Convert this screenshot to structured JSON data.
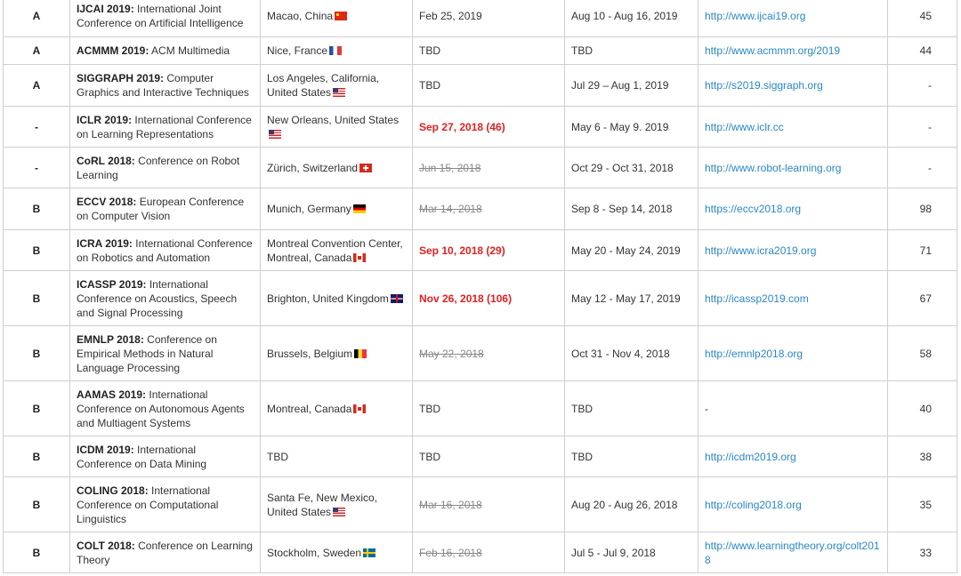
{
  "rows": [
    {
      "rank": "A",
      "abbr": "IJCAI 2019:",
      "full": " International Joint Conference on Artificial Intelligence",
      "location": "Macao, China",
      "flag": "china-flag-icon",
      "deadline": "Feb 25, 2019",
      "deadline_style": "normal",
      "dates": "Aug 10 - Aug 16, 2019",
      "url": "http://www.ijcai19.org",
      "h5": "45"
    },
    {
      "rank": "A",
      "abbr": "ACMMM 2019:",
      "full": " ACM Multimedia",
      "location": "Nice, France",
      "flag": "france-flag-icon",
      "deadline": "TBD",
      "deadline_style": "normal",
      "dates": "TBD",
      "url": "http://www.acmmm.org/2019",
      "h5": "44"
    },
    {
      "rank": "A",
      "abbr": "SIGGRAPH 2019:",
      "full": " Computer Graphics and Interactive Techniques",
      "location": "Los Angeles, California, United States",
      "flag": "usa-flag-icon",
      "deadline": "TBD",
      "deadline_style": "normal",
      "dates": "Jul 29 – Aug 1, 2019",
      "url": "http://s2019.siggraph.org",
      "h5": "-"
    },
    {
      "rank": "-",
      "abbr": "ICLR 2019:",
      "full": " International Conference on Learning Representations",
      "location": "New Orleans, United States",
      "flag": "usa-flag-icon",
      "deadline": "Sep 27, 2018 (46)",
      "deadline_style": "urgent",
      "dates": "May 6 - May 9. 2019",
      "url": "http://www.iclr.cc",
      "h5": "-"
    },
    {
      "rank": "-",
      "abbr": "CoRL 2018:",
      "full": " Conference on Robot Learning",
      "location": "Zürich, Switzerland",
      "flag": "switzerland-flag-icon",
      "deadline": "Jun 15, 2018",
      "deadline_style": "past",
      "dates": "Oct 29 - Oct 31, 2018",
      "url": "http://www.robot-learning.org",
      "h5": "-"
    },
    {
      "rank": "B",
      "abbr": "ECCV 2018:",
      "full": " European Conference on Computer Vision",
      "location": "Munich, Germany",
      "flag": "germany-flag-icon",
      "deadline": "Mar 14, 2018",
      "deadline_style": "past",
      "dates": "Sep 8 - Sep 14, 2018",
      "url": "https://eccv2018.org",
      "h5": "98"
    },
    {
      "rank": "B",
      "abbr": "ICRA 2019:",
      "full": " International Conference on Robotics and Automation",
      "location": "Montreal Convention Center, Montreal, Canada",
      "flag": "canada-flag-icon",
      "deadline": "Sep 10, 2018 (29)",
      "deadline_style": "urgent",
      "dates": "May 20 - May 24, 2019",
      "url": "http://www.icra2019.org",
      "h5": "71"
    },
    {
      "rank": "B",
      "abbr": "ICASSP 2019:",
      "full": " International Conference on Acoustics, Speech and Signal Processing",
      "location": "Brighton, United Kingdom",
      "flag": "uk-flag-icon",
      "deadline": "Nov 26, 2018 (106)",
      "deadline_style": "urgent",
      "dates": "May 12 - May 17, 2019",
      "url": "http://icassp2019.com",
      "h5": "67"
    },
    {
      "rank": "B",
      "abbr": "EMNLP 2018:",
      "full": " Conference on Empirical Methods in Natural Language Processing",
      "location": "Brussels, Belgium",
      "flag": "belgium-flag-icon",
      "deadline": "May 22, 2018",
      "deadline_style": "past",
      "dates": "Oct 31 - Nov 4, 2018",
      "url": "http://emnlp2018.org",
      "h5": "58"
    },
    {
      "rank": "B",
      "abbr": "AAMAS 2019:",
      "full": " International Conference on Autonomous Agents and Multiagent Systems",
      "location": "Montreal, Canada",
      "flag": "canada-flag-icon",
      "deadline": "TBD",
      "deadline_style": "normal",
      "dates": "TBD",
      "url": "-",
      "h5": "40"
    },
    {
      "rank": "B",
      "abbr": "ICDM 2019:",
      "full": " International Conference on Data Mining",
      "location": "TBD",
      "flag": "",
      "deadline": "TBD",
      "deadline_style": "normal",
      "dates": "TBD",
      "url": "http://icdm2019.org",
      "h5": "38"
    },
    {
      "rank": "B",
      "abbr": "COLING 2018:",
      "full": " International Conference on Computational Linguistics",
      "location": "Santa Fe, New Mexico, United States",
      "flag": "usa-flag-icon",
      "deadline": "Mar 16, 2018",
      "deadline_style": "past",
      "dates": "Aug 20 - Aug 26, 2018",
      "url": "http://coling2018.org",
      "h5": "35"
    },
    {
      "rank": "B",
      "abbr": "COLT 2018:",
      "full": " Conference on Learning Theory",
      "location": "Stockholm, Sweden",
      "flag": "sweden-flag-icon",
      "deadline": "Feb 16, 2018",
      "deadline_style": "past",
      "dates": "Jul 5 - Jul 9, 2018",
      "url": "http://www.learningtheory.org/colt2018",
      "h5": "33"
    }
  ]
}
